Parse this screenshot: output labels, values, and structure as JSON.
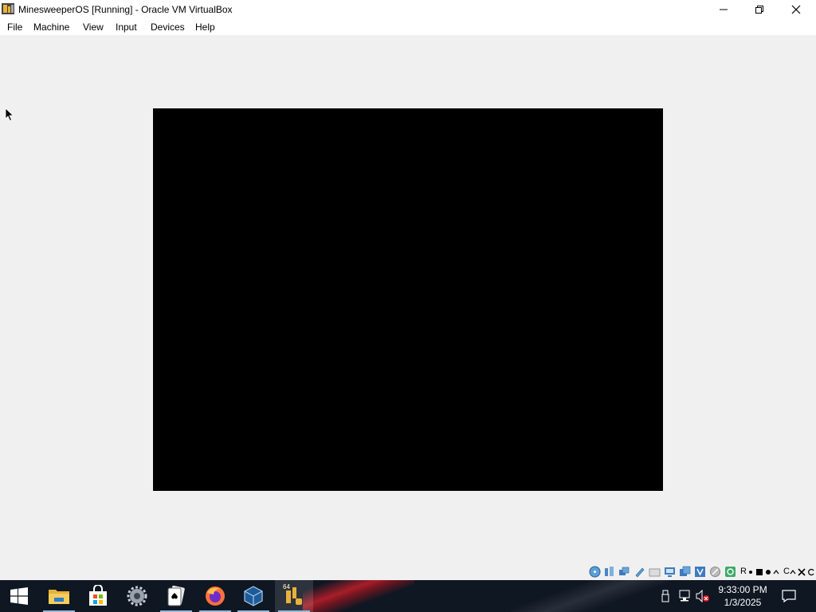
{
  "window": {
    "title": "MinesweeperOS [Running] - Oracle VM VirtualBox"
  },
  "menu": [
    "File",
    "Machine",
    "View",
    "Input",
    "Devices",
    "Help"
  ],
  "statusbar": {
    "icons": [
      "optical-drive-icon",
      "audio-icon",
      "network-icon",
      "usb-icon",
      "shared-folders-icon",
      "display-icon",
      "recording-icon",
      "vt-x-icon",
      "mouse-integration-icon",
      "keyboard-icon"
    ],
    "host_key_label": "R",
    "host_key_label2": "C"
  },
  "taskbar": {
    "apps": [
      "start-icon",
      "file-explorer-icon",
      "microsoft-store-icon",
      "settings-app-icon",
      "solitaire-icon",
      "firefox-icon",
      "virtualbox-icon",
      "virtualbox-vm-icon"
    ],
    "vm_badge": "64",
    "clock_time": "9:33:00 PM",
    "clock_date": "1/3/2025"
  },
  "colors": {
    "taskbar_bg": "#0f1722",
    "vm_screen": "#000000",
    "window_bg": "#f0f0f0",
    "accent_underline": "#8fb8de"
  }
}
